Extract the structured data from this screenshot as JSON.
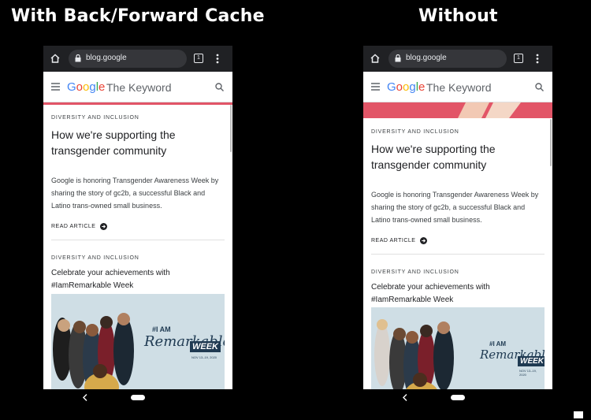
{
  "headings": {
    "left": "With Back/Forward Cache",
    "right": "Without"
  },
  "browser": {
    "url": "blog.google",
    "tab_count": "1",
    "icons": [
      "home-icon",
      "lock-icon",
      "tabs-icon",
      "overflow-menu-icon"
    ]
  },
  "site": {
    "logo": "Google",
    "name": "The Keyword",
    "icons": [
      "hamburger-menu-icon",
      "search-icon"
    ]
  },
  "articles": [
    {
      "category": "DIVERSITY AND INCLUSION",
      "title": "How we're supporting the transgender community",
      "description": "Google is honoring Transgender Awareness Week by sharing the story of gc2b, a successful Black and Latino trans-owned small business.",
      "cta": "READ ARTICLE"
    },
    {
      "category": "DIVERSITY AND INCLUSION",
      "title": "Celebrate your achievements with #IamRemarkable Week"
    }
  ],
  "promo": {
    "line1": "#I AM",
    "line2": "Remarkable",
    "badge": "WEEK",
    "dates": "NOV 13–19, 2020"
  },
  "colors": {
    "background": "#000000",
    "chrome_bar": "#202124",
    "hero_accent": "#e25567",
    "promo_bg": "#cfdee5"
  },
  "android_nav": {
    "icons": [
      "back-icon",
      "home-pill"
    ]
  }
}
